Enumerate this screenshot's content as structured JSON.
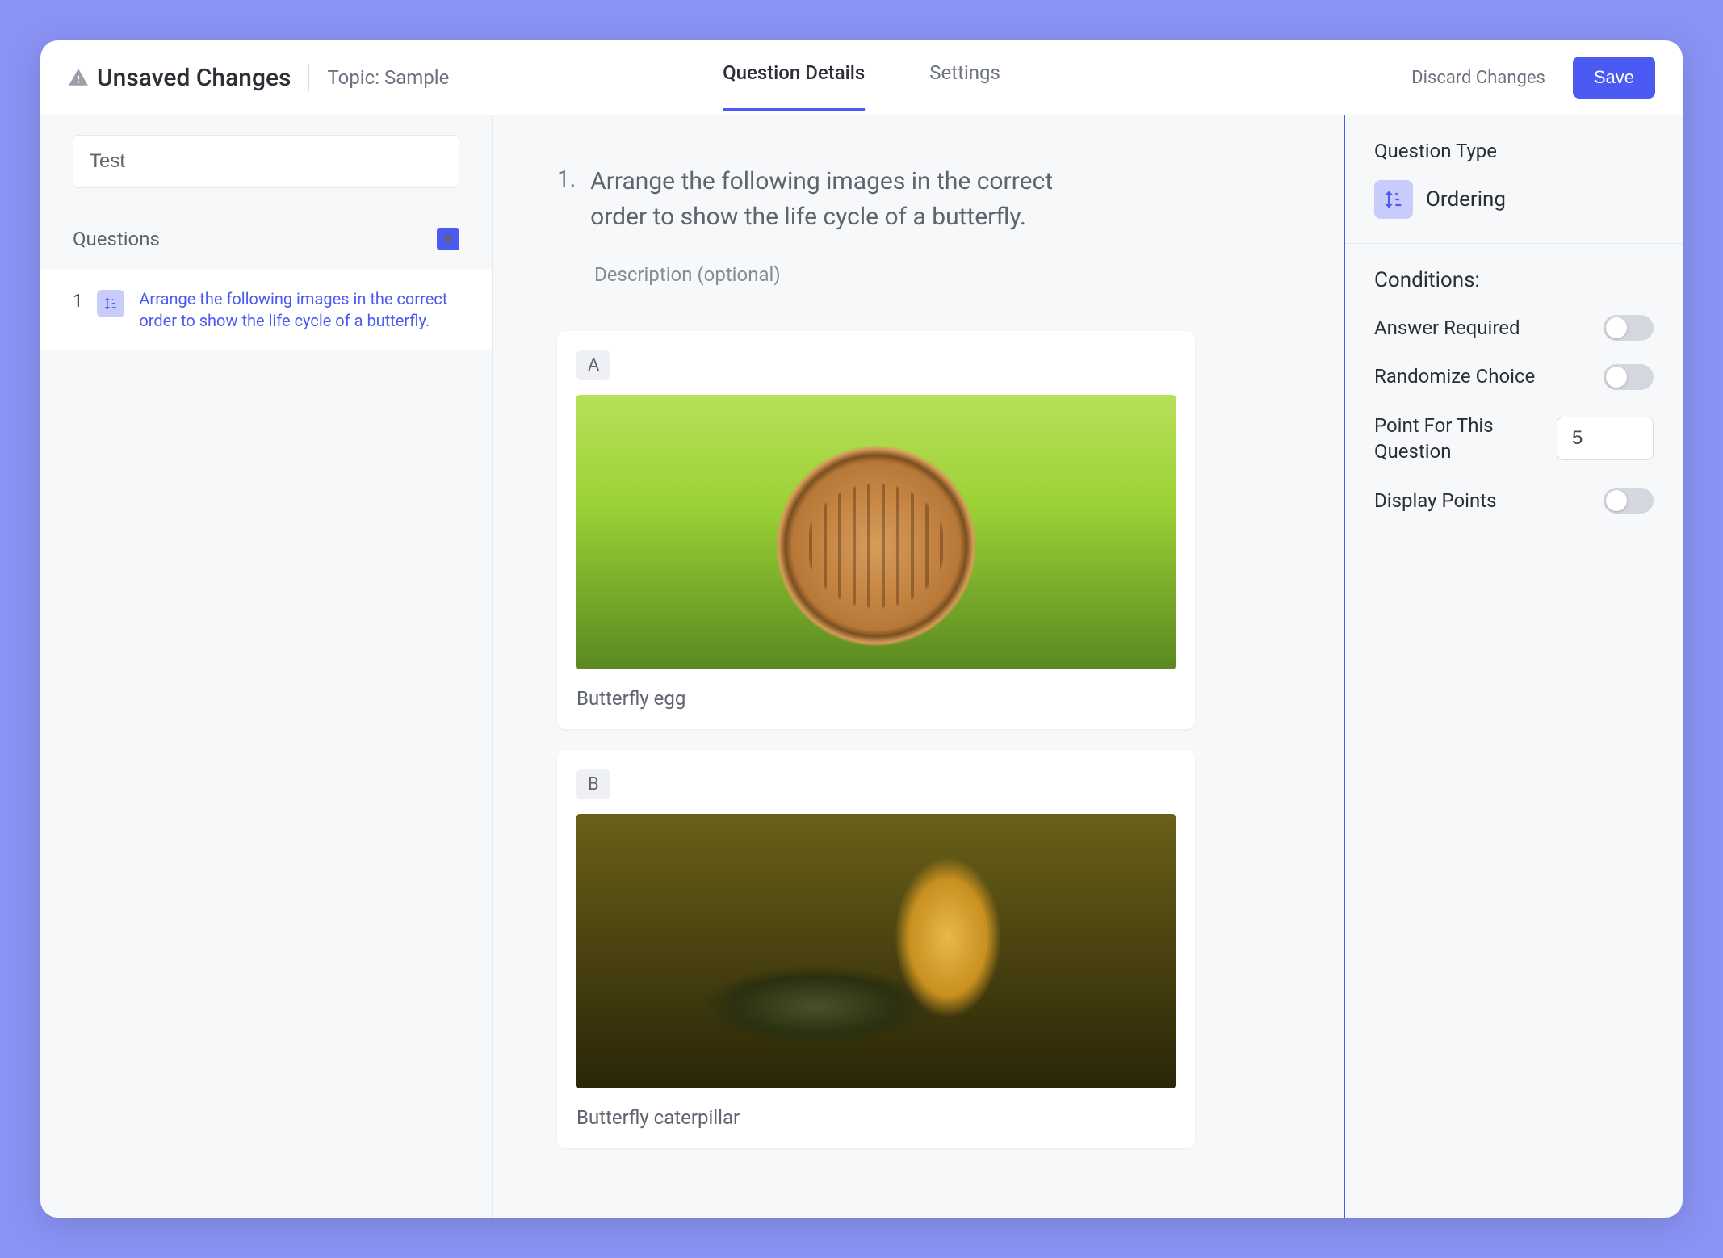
{
  "header": {
    "unsaved_label": "Unsaved Changes",
    "topic_label": "Topic: Sample",
    "tabs": {
      "details": "Question Details",
      "settings": "Settings"
    },
    "discard_label": "Discard Changes",
    "save_label": "Save"
  },
  "sidebar": {
    "title_value": "Test",
    "questions_label": "Questions",
    "items": [
      {
        "index": "1",
        "text": "Arrange the following images in the correct order to show the life cycle of a butterfly."
      }
    ]
  },
  "main": {
    "number": "1.",
    "prompt": "Arrange the following images in the correct order to show the life cycle of a butterfly.",
    "description_placeholder": "Description (optional)",
    "choices": [
      {
        "letter": "A",
        "caption": "Butterfly egg"
      },
      {
        "letter": "B",
        "caption": "Butterfly caterpillar"
      }
    ]
  },
  "right": {
    "question_type_label": "Question Type",
    "question_type_name": "Ordering",
    "conditions_label": "Conditions:",
    "answer_required_label": "Answer Required",
    "randomize_label": "Randomize Choice",
    "points_label": "Point For This Question",
    "points_value": "5",
    "display_points_label": "Display Points"
  }
}
